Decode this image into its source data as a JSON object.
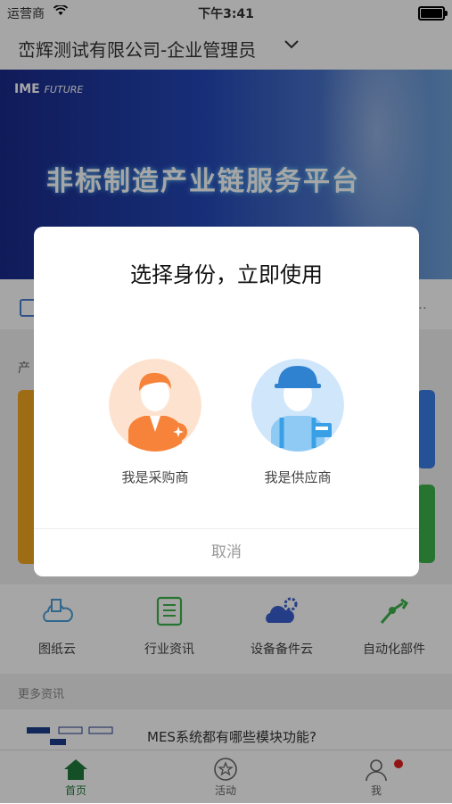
{
  "status_bar": {
    "carrier": "运营商",
    "time": "下午3:41"
  },
  "header": {
    "company": "峦辉测试有限公司-企业管理员",
    "dropdown_icon": "chevron-down-icon"
  },
  "banner": {
    "logo_main": "IME",
    "logo_sub": "FUTURE",
    "headline": "非标制造产业链服务平台"
  },
  "notice": {
    "more": "..."
  },
  "section": {
    "title": "产"
  },
  "quick_links": [
    {
      "label": "图纸云",
      "icon": "drawing-cloud-icon",
      "color": "#4a9fd8"
    },
    {
      "label": "行业资讯",
      "icon": "news-icon",
      "color": "#3cb24a"
    },
    {
      "label": "设备备件云",
      "icon": "parts-cloud-icon",
      "color": "#3a5fd0"
    },
    {
      "label": "自动化部件",
      "icon": "automation-icon",
      "color": "#3cb24a"
    }
  ],
  "more_news": {
    "label": "更多资讯"
  },
  "news_item": {
    "title": "MES系统都有哪些模块功能?"
  },
  "tabbar": [
    {
      "label": "首页",
      "icon": "home-icon",
      "active": true
    },
    {
      "label": "活动",
      "icon": "star-circle-icon",
      "active": false
    },
    {
      "label": "我",
      "icon": "user-icon",
      "active": false,
      "badge": true
    }
  ],
  "dialog": {
    "title": "选择身份，立即使用",
    "buyer_label": "我是采购商",
    "supplier_label": "我是供应商",
    "cancel_label": "取消"
  },
  "colors": {
    "accent_green": "#1f7a3b",
    "buyer_orange": "#f7833a",
    "supplier_blue": "#3aa0e6"
  }
}
